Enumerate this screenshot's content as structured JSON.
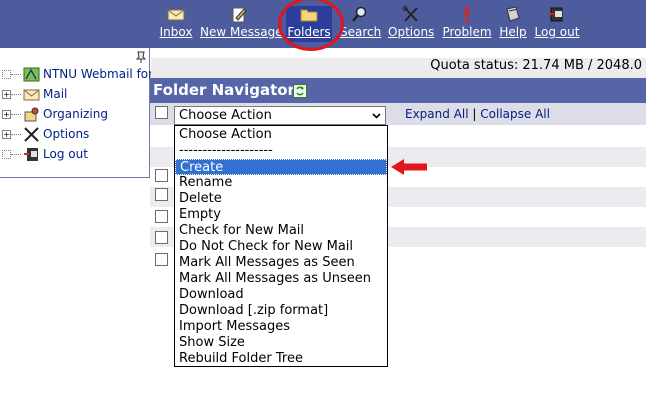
{
  "toolbar": {
    "items": [
      {
        "label": "Inbox",
        "icon": "envelope-icon"
      },
      {
        "label": "New Message",
        "icon": "compose-icon"
      },
      {
        "label": "Folders",
        "icon": "folder-icon"
      },
      {
        "label": "Search",
        "icon": "magnifier-icon"
      },
      {
        "label": "Options",
        "icon": "tools-icon"
      },
      {
        "label": "Problem",
        "icon": "exclamation-icon"
      },
      {
        "label": "Help",
        "icon": "book-icon"
      },
      {
        "label": "Log out",
        "icon": "logout-icon"
      }
    ],
    "active": "Folders",
    "highlight_color": "#e0161b"
  },
  "tree": {
    "items": [
      {
        "label": "NTNU Webmail for",
        "icon": "webmail-icon"
      },
      {
        "label": "Mail",
        "icon": "envelope-icon"
      },
      {
        "label": "Organizing",
        "icon": "organizing-icon"
      },
      {
        "label": "Options",
        "icon": "tools-icon"
      },
      {
        "label": "Log out",
        "icon": "logout-icon"
      }
    ]
  },
  "quota": {
    "text": "Quota status: 21.74 MB / 2048.0"
  },
  "navigator": {
    "title": "Folder Navigator",
    "select_value": "Choose Action",
    "expand_all": "Expand All",
    "separator": "|",
    "collapse_all": "Collapse All"
  },
  "dropdown": {
    "options": [
      "Choose Action",
      "--------------------",
      "Create",
      "Rename",
      "Delete",
      "Empty",
      "Check for New Mail",
      "Do Not Check for New Mail",
      "Mark All Messages as Seen",
      "Mark All Messages as Unseen",
      "Download",
      "Download [.zip format]",
      "Import Messages",
      "Show Size",
      "Rebuild Folder Tree"
    ],
    "highlighted": "Create"
  },
  "colors": {
    "toolbar_bg": "#4d5c9d",
    "header_bg": "#5565a7",
    "highlight_option": "#3270d1",
    "annotation_red": "#e0161b"
  }
}
